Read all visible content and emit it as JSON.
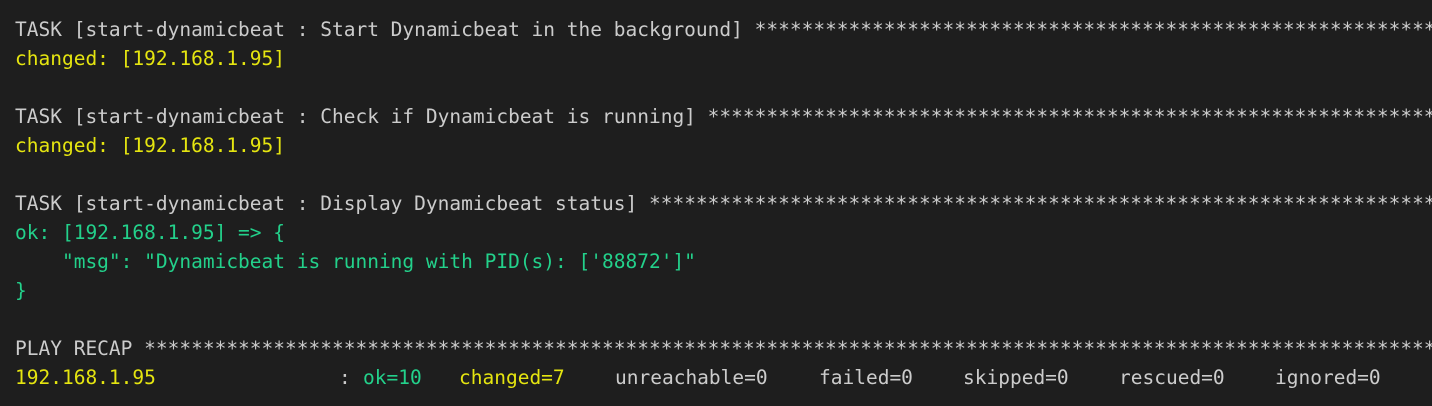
{
  "colors": {
    "background": "#1e1e1e",
    "default_text": "#cccccc",
    "changed": "#e5e510",
    "ok": "#23d18b"
  },
  "task1": {
    "header": "TASK [start-dynamicbeat : Start Dynamicbeat in the background] ",
    "stars": "***********************************************************************",
    "result": "changed: [192.168.1.95]"
  },
  "task2": {
    "header": "TASK [start-dynamicbeat : Check if Dynamicbeat is running] ",
    "stars": "****************************************************************************",
    "result": "changed: [192.168.1.95]"
  },
  "task3": {
    "header": "TASK [start-dynamicbeat : Display Dynamicbeat status] ",
    "stars": "*********************************************************************************",
    "result_open": "ok: [192.168.1.95] => {",
    "msg_line": "    \"msg\": \"Dynamicbeat is running with PID(s): ['88872']\"",
    "result_close": "}"
  },
  "recap": {
    "header": "PLAY RECAP ",
    "stars": "*******************************************************************************************************************************",
    "host": "192.168.1.95",
    "separator": ":",
    "ok": "ok=10",
    "changed": "changed=7",
    "unreachable": "unreachable=0",
    "failed": "failed=0",
    "skipped": "skipped=0",
    "rescued": "rescued=0",
    "ignored": "ignored=0"
  }
}
